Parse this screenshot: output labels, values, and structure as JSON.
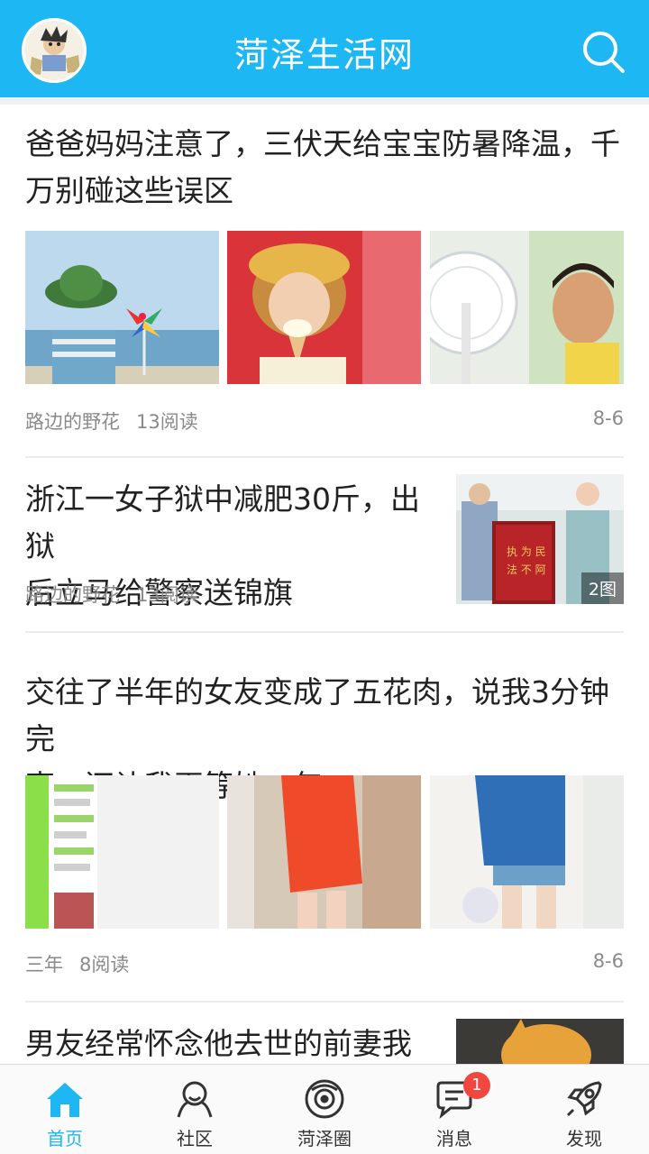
{
  "header": {
    "title": "菏泽生活网"
  },
  "articles": [
    {
      "title_line1": "爸爸妈妈注意了，三伏天给宝宝防暑降温，千",
      "title_line2": "万别碰这些误区",
      "author": "路边的野花",
      "reads": "13阅读",
      "date": "8-6"
    },
    {
      "title_line1": "浙江一女子狱中减肥30斤，出狱",
      "title_line2": "后立马给警察送锦旗",
      "author": "路边的野花",
      "reads": "13阅读",
      "pics": "2图"
    },
    {
      "title_line1": "交往了半年的女友变成了五花肉，说我3分钟完",
      "title_line2": "事，还让我再等她一年...",
      "author": "三年",
      "reads": "8阅读",
      "date": "8-6"
    },
    {
      "title_line1": "男友经常怀念他去世的前妻我该"
    }
  ],
  "tabs": [
    {
      "label": "首页",
      "icon": "home-icon",
      "active": true
    },
    {
      "label": "社区",
      "icon": "community-icon"
    },
    {
      "label": "菏泽圈",
      "icon": "circle-icon"
    },
    {
      "label": "消息",
      "icon": "message-icon",
      "badge": "1"
    },
    {
      "label": "发现",
      "icon": "rocket-icon"
    }
  ],
  "colors": {
    "brand": "#1db7f3",
    "badge": "#f2473f"
  }
}
